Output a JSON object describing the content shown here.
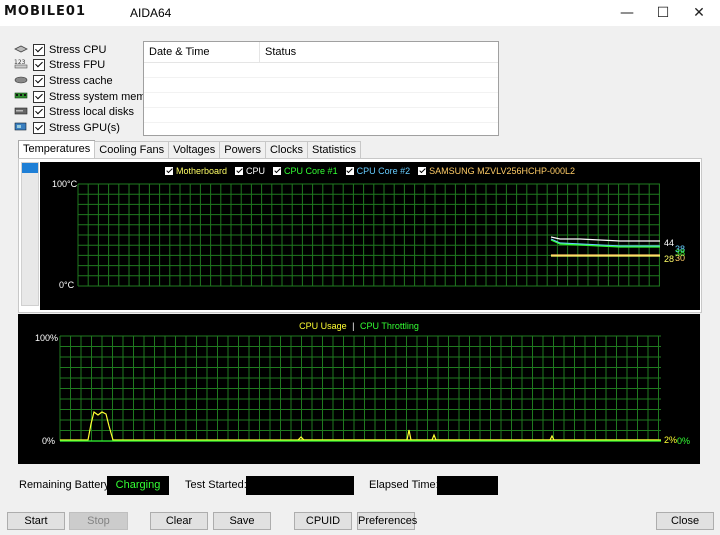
{
  "titlebar": {
    "logo": "MOBILE01",
    "app_title": "AIDA64",
    "minimize": "—",
    "maximize": "☐",
    "close": "✕"
  },
  "stress_items": [
    {
      "label": "Stress CPU",
      "icon": "cpu-icon",
      "checked": true
    },
    {
      "label": "Stress FPU",
      "icon": "fpu-icon",
      "checked": true
    },
    {
      "label": "Stress cache",
      "icon": "cache-icon",
      "checked": true
    },
    {
      "label": "Stress system memory",
      "icon": "memory-icon",
      "checked": true
    },
    {
      "label": "Stress local disks",
      "icon": "disk-icon",
      "checked": true
    },
    {
      "label": "Stress GPU(s)",
      "icon": "gpu-icon",
      "checked": true
    }
  ],
  "log": {
    "col_datetime": "Date & Time",
    "col_status": "Status"
  },
  "tabs": [
    "Temperatures",
    "Cooling Fans",
    "Voltages",
    "Powers",
    "Clocks",
    "Statistics"
  ],
  "active_tab": "Temperatures",
  "temp_graph": {
    "legend": [
      {
        "label": "Motherboard",
        "color": "#ffff66"
      },
      {
        "label": "CPU",
        "color": "#ffffff"
      },
      {
        "label": "CPU Core #1",
        "color": "#33ff33"
      },
      {
        "label": "CPU Core #2",
        "color": "#66ccff"
      },
      {
        "label": "SAMSUNG MZVLV256HCHP-000L2",
        "color": "#ffcc66"
      }
    ],
    "y_top": "100°C",
    "y_bottom": "0°C",
    "values": [
      {
        "text": "44",
        "color": "#ffffff"
      },
      {
        "text": "38",
        "color": "#66ccff"
      },
      {
        "text": "38",
        "color": "#33ff33"
      },
      {
        "text": "28",
        "color": "#ffff66"
      },
      {
        "text": "30",
        "color": "#ffcc66"
      }
    ]
  },
  "usage_graph": {
    "legend_usage": "CPU Usage",
    "legend_sep": "|",
    "legend_throttle": "CPU Throttling",
    "usage_color": "#ffff33",
    "throttle_color": "#33ff33",
    "y_top": "100%",
    "y_bottom": "0%",
    "value_usage": "2%",
    "value_throttle": "0%"
  },
  "status": {
    "battery_label": "Remaining Battery:",
    "battery_value": "Charging",
    "test_started_label": "Test Started:",
    "test_started_value": "",
    "elapsed_label": "Elapsed Time:",
    "elapsed_value": ""
  },
  "buttons": {
    "start": "Start",
    "stop": "Stop",
    "clear": "Clear",
    "save": "Save",
    "cpuid": "CPUID",
    "preferences": "Preferences",
    "close": "Close"
  }
}
